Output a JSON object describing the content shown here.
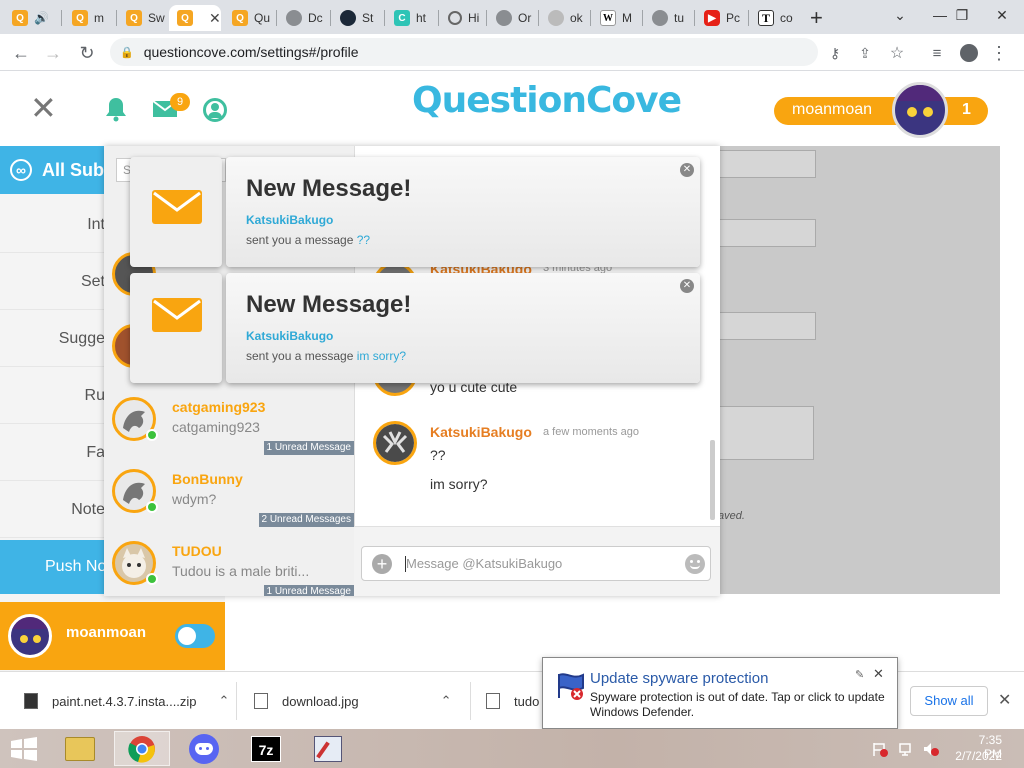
{
  "browser": {
    "tabs": [
      {
        "icon": "questioncove-icon",
        "title": "",
        "active": false
      },
      {
        "icon": "questioncove-icon",
        "title": "m",
        "active": false
      },
      {
        "icon": "questioncove-icon",
        "title": "Sw",
        "active": false
      },
      {
        "icon": "questioncove-icon",
        "title": "",
        "active": true
      },
      {
        "icon": "questioncove-icon",
        "title": "Qu",
        "active": false
      },
      {
        "icon": "globe-icon",
        "title": "Dc",
        "active": false
      },
      {
        "icon": "steam-icon",
        "title": "St",
        "active": false
      },
      {
        "icon": "site-icon",
        "title": "ht",
        "active": false
      },
      {
        "icon": "history-icon",
        "title": "Hi",
        "active": false
      },
      {
        "icon": "globe-icon",
        "title": "Or",
        "active": false
      },
      {
        "icon": "globe-icon",
        "title": "ok",
        "active": false
      },
      {
        "icon": "wikipedia-icon",
        "title": "M",
        "active": false
      },
      {
        "icon": "globe-icon",
        "title": "tu",
        "active": false
      },
      {
        "icon": "youtube-icon",
        "title": "Pc",
        "active": false
      },
      {
        "icon": "t-icon",
        "title": "co",
        "active": false
      }
    ],
    "url": "questioncove.com/settings#/profile"
  },
  "site": {
    "logo": "QuestionCove",
    "mail_badge": "9",
    "username": "moanmoan",
    "points": "1"
  },
  "sidebar": {
    "all_sub": "All Sub",
    "items": [
      "Int",
      "Set",
      "Sugge",
      "Ru",
      "Fa",
      "Note"
    ],
    "push": "Push No",
    "profile_name": "moanmoan"
  },
  "chat": {
    "search_placeholder": "S",
    "list": [
      {
        "name": "catgaming923",
        "preview": "catgaming923",
        "unread": "1 Unread Message"
      },
      {
        "name": "BonBunny",
        "preview": "wdym?",
        "unread": "2 Unread Messages"
      },
      {
        "name": "TUDOU",
        "preview": "Tudou is a male briti...",
        "unread": "1 Unread Message"
      }
    ],
    "messages": [
      {
        "name": "KatsukiBakugo",
        "time": "3 minutes ago",
        "lines": []
      },
      {
        "name": "",
        "time": "",
        "lines": [
          "yo u cute cute"
        ]
      },
      {
        "name": "KatsukiBakugo",
        "time": "a few moments ago",
        "lines": [
          "??",
          "im sorry?"
        ]
      }
    ],
    "input_placeholder": "Message @KatsukiBakugo"
  },
  "notifications": [
    {
      "title": "New Message!",
      "from": "KatsukiBakugo",
      "body": "sent you a message",
      "link": "??"
    },
    {
      "title": "New Message!",
      "from": "KatsukiBakugo",
      "body": "sent you a message",
      "link": "im sorry?"
    }
  ],
  "behind_text": "aved.",
  "downloads": {
    "items": [
      "paint.net.4.3.7.insta....zip",
      "download.jpg",
      "tudo"
    ],
    "show_all": "Show all"
  },
  "toast": {
    "title": "Update spyware protection",
    "body": "Spyware protection is out of date. Tap or click to update Windows Defender."
  },
  "taskbar": {
    "time": "7:35 PM",
    "date": "2/7/2022",
    "apps": [
      "file-explorer-icon",
      "chrome-icon",
      "discord-icon",
      "7zip-icon",
      "paintnet-icon"
    ]
  },
  "colors": {
    "accent": "#3fb4e6",
    "orange": "#f9a510",
    "name_orange": "#e67e22"
  }
}
